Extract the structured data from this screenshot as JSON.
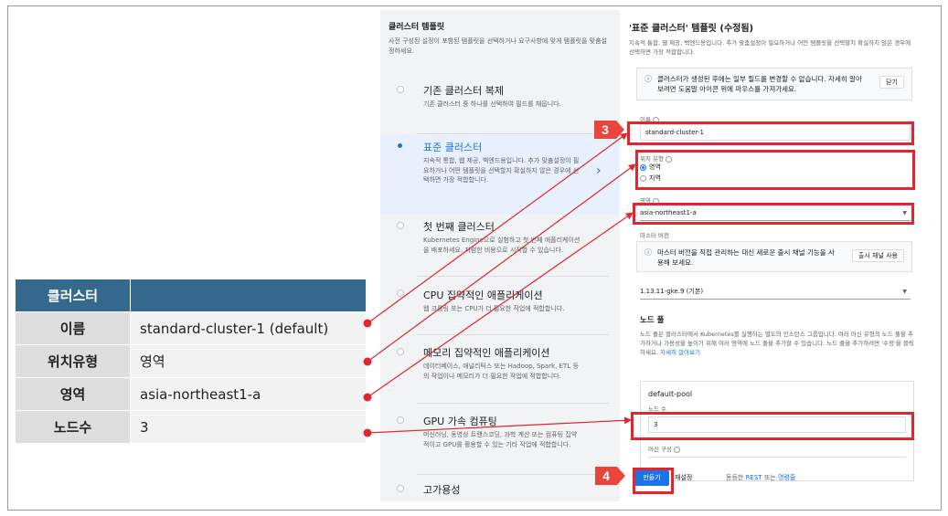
{
  "summary": {
    "header": "클러스터",
    "rows": [
      {
        "key": "이름",
        "value": "standard-cluster-1 (default)"
      },
      {
        "key": "위치유형",
        "value": "영역"
      },
      {
        "key": "영역",
        "value": "asia-northeast1-a"
      },
      {
        "key": "노드수",
        "value": "3"
      }
    ]
  },
  "left_panel": {
    "title": "클러스터 템플릿",
    "desc": "사전 구성된 설정이 포함된 템플릿을 선택하거나 요구사항에 맞게 템플릿을 맞춤설정하세요.",
    "options": [
      {
        "name": "기존 클러스터 복제",
        "desc": "기존 클러스터 중 하나를 선택하여 필드를 채웁니다."
      },
      {
        "name": "표준 클러스터",
        "desc": "지속적 통합, 웹 제공, 백엔드용입니다. 추가 맞춤설정이 필요하거나 어떤 템플릿을 선택할지 확실하지 않은 경우에 선택하면 가장 적합합니다."
      },
      {
        "name": "첫 번째 클러스터",
        "desc": "Kubernetes Engine으로 실험하고 첫 번째 애플리케이션을 배포하세요. 저렴한 비용으로 시작할 수 있습니다."
      },
      {
        "name": "CPU 집약적인 애플리케이션",
        "desc": "웹 크롤링 또는 CPU가 더 필요한 작업에 적합합니다."
      },
      {
        "name": "메모리 집약적인 애플리케이션",
        "desc": "데이터베이스, 애널리틱스 또는 Hadoop, Spark, ETL 등의 작업이나 메모리가 더 필요한 작업에 적합합니다."
      },
      {
        "name": "GPU 가속 컴퓨팅",
        "desc": "머신러닝, 동영상 트랜스코딩, 과학 계산 또는 컴퓨팅 집약적이고 GPU를 활용할 수 있는 기타 작업에 적합합니다."
      },
      {
        "name": "고가용성",
        "desc": ""
      }
    ]
  },
  "right_panel": {
    "title": "'표준 클러스터' 템플릿 (수정됨)",
    "desc": "지속적 통합, 웹 제공, 백엔드용입니다. 추가 맞춤설정이 필요하거나 어떤 템플릿을 선택할지 확실하지 않은 경우에 선택하면 가장 적합합니다.",
    "info1": {
      "text": "클러스터가 생성된 후에는 일부 필드를 변경할 수 없습니다. 자세히 알아보려면 도움말 아이콘 위에 마우스를 가져가세요.",
      "button": "닫기"
    },
    "name_label": "이름",
    "name_value": "standard-cluster-1",
    "loc_label": "위치 유형",
    "loc_zone": "영역",
    "loc_region": "지역",
    "zone_label": "영역",
    "zone_value": "asia-northeast1-a",
    "master_label": "마스터 버전",
    "info2": {
      "text": "마스터 버전을 직접 관리하는 대신 새로운 출시 채널 기능을 사용해 보세요.",
      "button": "출시 채널 사용"
    },
    "version_value": "1.13.11-gke.9 (기본)",
    "pool_title": "노드 풀",
    "pool_desc": "노드 풀은 클러스터에서 Kubernetes를 실행하는 별도의 인스턴스 그룹입니다. 여러 머신 유형의 노드 풀을 추가하거나 가용성을 높이기 위해 여러 영역에 노드 풀을 추가할 수 있습니다. 노드 풀을 추가하려면 '수정'을 클릭하세요.",
    "pool_link": "자세히 알아보기",
    "pool_name": "default-pool",
    "nodes_label": "노드 수",
    "nodes_value": "3",
    "machine_label": "머신 구성",
    "create_button": "만들기",
    "reset_button": "재설정",
    "equiv_text": "동등한",
    "equiv_rest": "REST",
    "equiv_or": "또는",
    "equiv_cmd": "명령줄"
  },
  "callouts": {
    "step3": "3",
    "step4": "4"
  },
  "colors": {
    "accent": "#1a73e8",
    "callout": "#e0262f",
    "header": "#34698d"
  }
}
